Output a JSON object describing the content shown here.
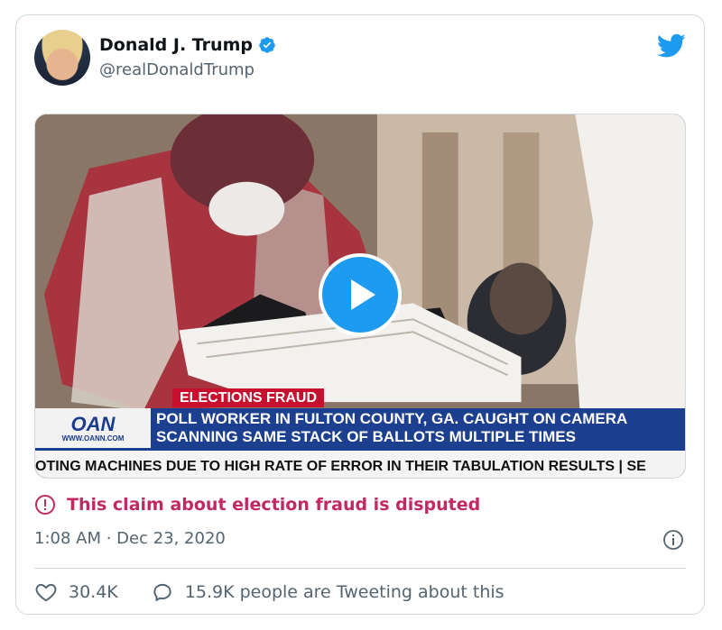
{
  "tweet": {
    "author_name": "Donald J. Trump",
    "author_handle": "@realDonaldTrump",
    "timestamp": "1:08 AM · Dec 23, 2020"
  },
  "video": {
    "tag": "ELECTIONS FRAUD",
    "logo": "OAN",
    "logo_url": "WWW.OANN.COM",
    "headline_line1": "POLL WORKER IN FULTON COUNTY, GA. CAUGHT ON CAMERA",
    "headline_line2": "SCANNING SAME STACK OF BALLOTS MULTIPLE TIMES",
    "ticker": "OTING MACHINES DUE TO HIGH RATE OF ERROR IN THEIR TABULATION RESULTS  |  SE"
  },
  "notice": {
    "text": "This claim about election fraud is disputed"
  },
  "stats": {
    "likes": "30.4K",
    "reply_text": "15.9K people are Tweeting about this"
  },
  "colors": {
    "brand_blue": "#1d9bf0",
    "disputed_red": "#c22962",
    "muted": "#536471"
  },
  "icons": {
    "verified": "verified-badge-icon",
    "brand": "twitter-bird-icon",
    "warning": "exclamation-circle-icon",
    "info": "info-icon",
    "like": "heart-icon",
    "reply": "speech-bubble-icon",
    "play": "play-icon"
  }
}
